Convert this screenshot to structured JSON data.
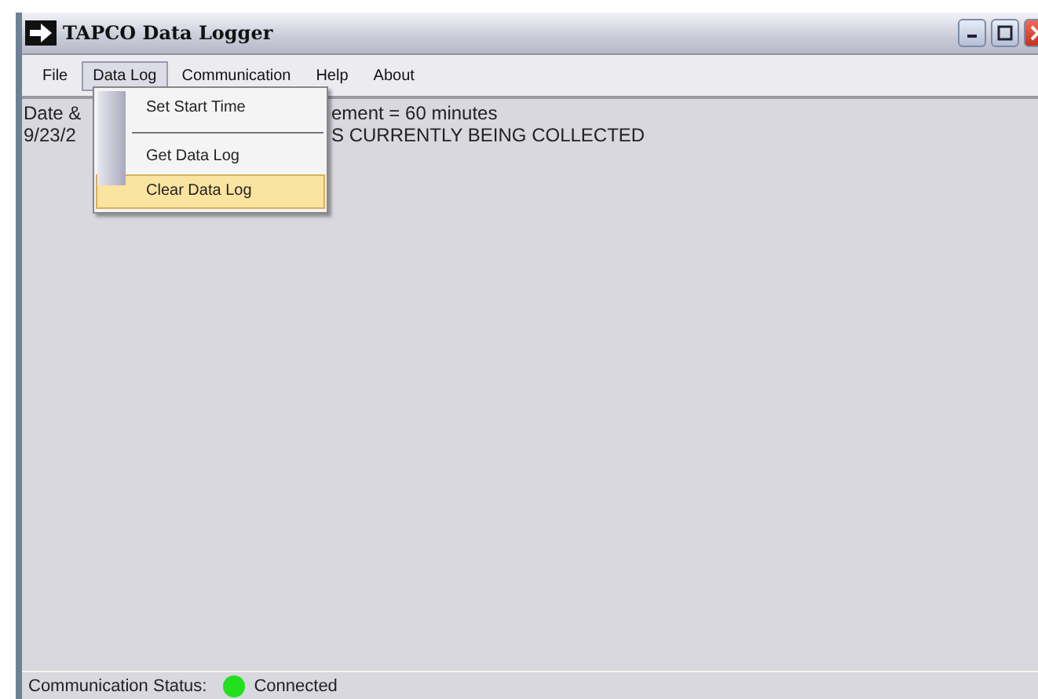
{
  "window": {
    "title": "TAPCO Data Logger"
  },
  "menu_bar": [
    {
      "label": "File",
      "selected": false
    },
    {
      "label": "Data Log",
      "selected": true
    },
    {
      "label": "Communication",
      "selected": false
    },
    {
      "label": "Help",
      "selected": false
    },
    {
      "label": "About",
      "selected": false
    }
  ],
  "dropdown": [
    {
      "label": "Set Start Time",
      "selected": false,
      "separator_after": true
    },
    {
      "label": "Get Data Log",
      "selected": false,
      "separator_after": false
    },
    {
      "label": "Clear Data Log",
      "selected": true,
      "separator_after": false
    }
  ],
  "log_lines": [
    {
      "left": "Date &",
      "right": "ement = 60 minutes"
    },
    {
      "left": "9/23/2",
      "right": "S CURRENTLY BEING COLLECTED"
    }
  ],
  "status_bar": {
    "label": "Communication Status:",
    "status": "Connected",
    "color": "#22e01e"
  }
}
